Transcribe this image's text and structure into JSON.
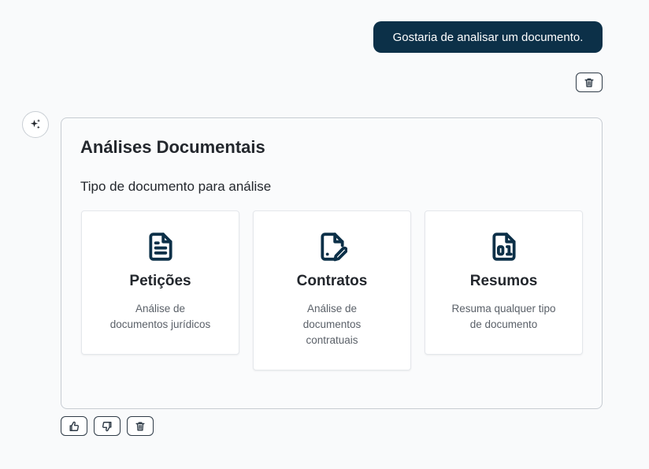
{
  "user_message": {
    "text": "Gostaria de analisar um documento."
  },
  "assistant_card": {
    "title": "Análises Documentais",
    "subtitle": "Tipo de documento para análise",
    "options": [
      {
        "icon": "file-text-icon",
        "title": "Petições",
        "desc_lines": [
          "Análise de",
          "documentos jurídicos"
        ]
      },
      {
        "icon": "file-signature-icon",
        "title": "Contratos",
        "desc_lines": [
          "Análise de",
          "documentos",
          "contratuais"
        ]
      },
      {
        "icon": "file-binary-icon",
        "title": "Resumos",
        "desc_lines": [
          "Resuma qualquer tipo",
          "de documento"
        ]
      }
    ]
  },
  "colors": {
    "accent": "#0c3048",
    "border": "#c7ccd2",
    "background": "#f9fafb"
  }
}
